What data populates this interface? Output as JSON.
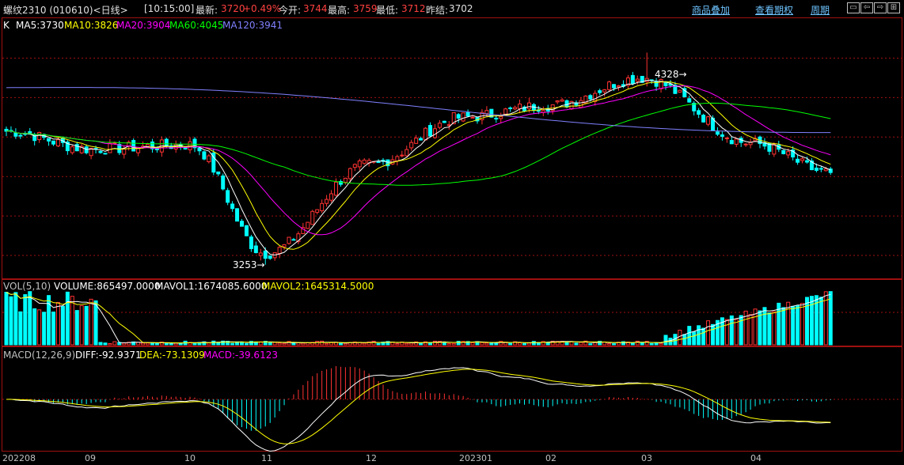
{
  "header": {
    "title": "螺纹2310 (010610)<日线>",
    "time": "[10:15:00]",
    "last_label": "最新:",
    "last_value": "3720",
    "change": "+0.49%",
    "open_label": "今开:",
    "open_value": "3744",
    "high_label": "最高:",
    "high_value": "3759",
    "low_label": "最低:",
    "low_value": "3712",
    "prev_label": "昨结:",
    "prev_value": "3702",
    "links": [
      "商品叠加",
      "查看期权",
      "周期"
    ],
    "nav_icons": [
      "window-restore-icon",
      "arrow-left-icon",
      "arrow-right-icon",
      "expand-icon"
    ]
  },
  "price_panel": {
    "k_label": "K",
    "ma": [
      {
        "text": "MA5:3730",
        "color": "#ffffff"
      },
      {
        "text": "MA10:3826",
        "color": "#ffff00"
      },
      {
        "text": "MA20:3904",
        "color": "#ff00ff"
      },
      {
        "text": "MA60:4045",
        "color": "#00ff00"
      },
      {
        "text": "MA120:3941",
        "color": "#8080ff"
      }
    ],
    "high_mark": "4328",
    "low_mark": "3253"
  },
  "vol_panel": {
    "title": "VOL(5,10)",
    "volume": "VOLUME:865497.0000",
    "mavol1": "MAVOL1:1674085.6000",
    "mavol2": "MAVOL2:1645314.5000"
  },
  "macd_panel": {
    "title": "MACD(12,26,9)",
    "diff": "DIFF:-92.9371",
    "dea": "DEA:-73.1309",
    "macd": "MACD:-39.6123"
  },
  "x_labels": [
    "202208",
    "09",
    "10",
    "11",
    "12",
    "202301",
    "02",
    "03",
    "04"
  ],
  "colors": {
    "up": "#ff3232",
    "down": "#00ffff",
    "grid": "#a01010",
    "ma5": "#ffffff",
    "ma10": "#ffff00",
    "ma20": "#ff00ff",
    "ma60": "#00ff00",
    "ma120": "#8080ff"
  },
  "chart_data": {
    "type": "candlestick",
    "title": "螺纹2310 (010610)<日线>",
    "x_labels": [
      "202208",
      "09",
      "10",
      "11",
      "12",
      "202301",
      "02",
      "03",
      "04"
    ],
    "price_range": [
      3200,
      4450
    ],
    "price_anchors": [
      {
        "period": "202208",
        "close": 3930
      },
      {
        "period": "09",
        "close": 3840
      },
      {
        "period": "10",
        "close": 3860
      },
      {
        "period": "11",
        "close": 3310
      },
      {
        "period": "12",
        "close": 3760
      },
      {
        "period": "202301",
        "close": 4000
      },
      {
        "period": "02",
        "close": 4060
      },
      {
        "period": "03",
        "close": 4200
      },
      {
        "period": "04",
        "close": 3870
      },
      {
        "period": "last",
        "close": 3720
      }
    ],
    "series": [
      {
        "name": "MA5",
        "last": 3730
      },
      {
        "name": "MA10",
        "last": 3826
      },
      {
        "name": "MA20",
        "last": 3904
      },
      {
        "name": "MA60",
        "last": 4045
      },
      {
        "name": "MA120",
        "last": 3941
      }
    ],
    "annotations": [
      {
        "label": "4328",
        "value": 4328
      },
      {
        "label": "3253",
        "value": 3253
      }
    ],
    "volume": {
      "last": 865497.0,
      "mavol1": 1674085.6,
      "mavol2": 1645314.5
    },
    "macd": {
      "diff": -92.9371,
      "dea": -73.1309,
      "macd": -39.6123
    }
  }
}
